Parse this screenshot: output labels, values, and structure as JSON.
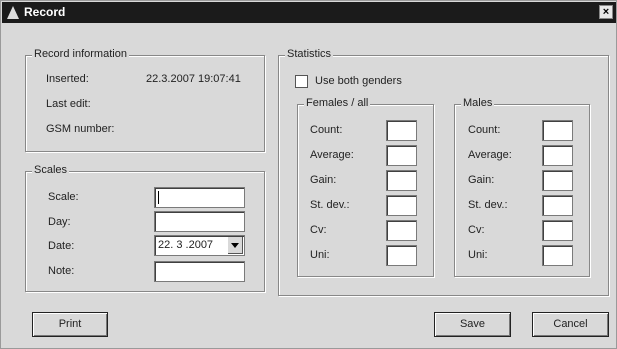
{
  "window": {
    "title": "Record",
    "close_symbol": "×"
  },
  "record_info": {
    "legend": "Record information",
    "inserted_label": "Inserted:",
    "inserted_value": "22.3.2007 19:07:41",
    "last_edit_label": "Last edit:",
    "gsm_label": "GSM number:"
  },
  "scales": {
    "legend": "Scales",
    "scale_label": "Scale:",
    "scale_value": "",
    "day_label": "Day:",
    "day_value": "",
    "date_label": "Date:",
    "date_value": "22. 3 .2007",
    "note_label": "Note:",
    "note_value": ""
  },
  "statistics": {
    "legend": "Statistics",
    "both_genders_label": "Use both genders",
    "both_genders_checked": false,
    "females": {
      "legend": "Females / all",
      "rows": [
        "Count:",
        "Average:",
        "Gain:",
        "St. dev.:",
        "Cv:",
        "Uni:"
      ]
    },
    "males": {
      "legend": "Males",
      "rows": [
        "Count:",
        "Average:",
        "Gain:",
        "St. dev.:",
        "Cv:",
        "Uni:"
      ]
    }
  },
  "buttons": {
    "print": "Print",
    "save": "Save",
    "cancel": "Cancel"
  }
}
